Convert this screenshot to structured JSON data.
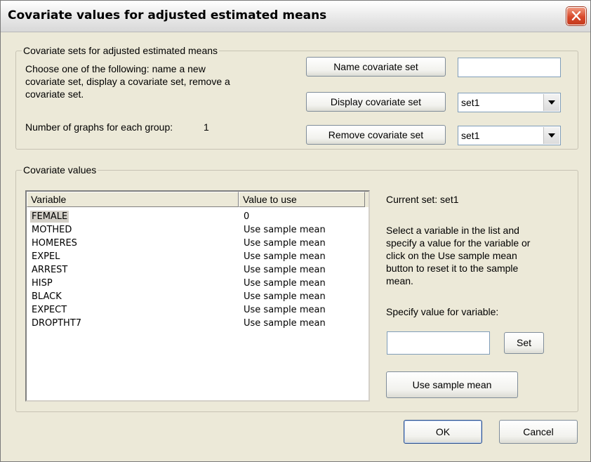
{
  "window": {
    "title": "Covariate values for adjusted estimated means"
  },
  "sets_group": {
    "legend": "Covariate sets for adjusted estimated means",
    "instructions": [
      "Choose one of the following:  name a new",
      "covariate set, display a covariate set, remove a",
      "covariate set."
    ],
    "graphs_label": "Number of graphs for each group:",
    "graphs_value": "1",
    "name_button": "Name covariate set",
    "name_input_value": "",
    "display_button": "Display covariate set",
    "display_select_value": "set1",
    "remove_button": "Remove covariate set",
    "remove_select_value": "set1"
  },
  "values_group": {
    "legend": "Covariate values",
    "columns": [
      "Variable",
      "Value to use"
    ],
    "rows": [
      {
        "variable": "FEMALE",
        "value": "0",
        "selected": true
      },
      {
        "variable": "MOTHED",
        "value": "Use sample mean"
      },
      {
        "variable": "HOMERES",
        "value": "Use sample mean"
      },
      {
        "variable": "EXPEL",
        "value": "Use sample mean"
      },
      {
        "variable": "ARREST",
        "value": "Use sample mean"
      },
      {
        "variable": "HISP",
        "value": "Use sample mean"
      },
      {
        "variable": "BLACK",
        "value": "Use sample mean"
      },
      {
        "variable": "EXPECT",
        "value": "Use sample mean"
      },
      {
        "variable": "DROPTHT7",
        "value": "Use sample mean"
      }
    ],
    "current_set": "Current set: set1",
    "help_text": [
      "Select a variable in the list and",
      "specify a value for the variable or",
      "click on the Use sample mean",
      "button to reset it to the sample",
      "mean."
    ],
    "specify_label": "Specify value for variable:",
    "value_input": "",
    "set_button": "Set",
    "use_mean_button": "Use sample mean"
  },
  "footer": {
    "ok": "OK",
    "cancel": "Cancel"
  },
  "colors": {
    "dialog_bg": "#ece9d8",
    "close_red": "#d8482a",
    "selection": "#d4d0c8"
  }
}
